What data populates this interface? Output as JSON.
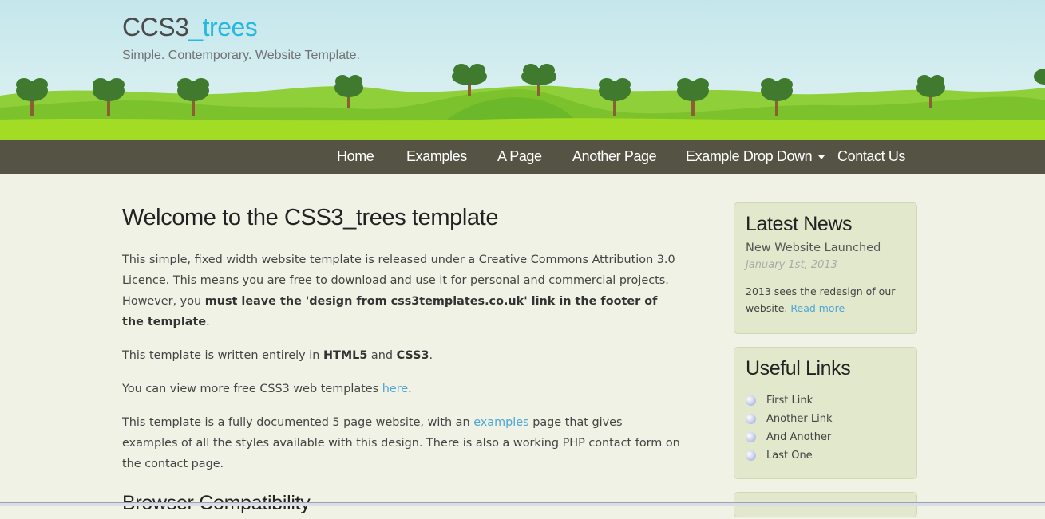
{
  "header": {
    "logo_main": "CCS3",
    "logo_accent": "_trees",
    "slogan": "Simple. Contemporary. Website Template."
  },
  "nav": {
    "items": [
      "Home",
      "Examples",
      "A Page",
      "Another Page",
      "Example Drop Down",
      "Contact Us"
    ]
  },
  "content": {
    "title": "Welcome to the CSS3_trees template",
    "p1_a": "This simple, fixed width website template is released under a Creative Commons Attribution 3.0 Licence. This means you are free to download and use it for personal and commercial projects. However, you ",
    "p1_bold": "must leave the 'design from css3templates.co.uk' link in the footer of the template",
    "p1_end": ".",
    "p2_a": "This template is written entirely in ",
    "p2_html5": "HTML5",
    "p2_and": " and ",
    "p2_css3": "CSS3",
    "p2_end": ".",
    "p3_a": "You can view more free CSS3 web templates ",
    "p3_link": "here",
    "p3_end": ".",
    "p4_a": "This template is a fully documented 5 page website, with an ",
    "p4_link": "examples",
    "p4_b": " page that gives examples of all the styles available with this design. There is also a working PHP contact form on the contact page.",
    "subtitle": "Browser Compatibility"
  },
  "sidebar": {
    "news": {
      "heading": "Latest News",
      "item_title": "New Website Launched",
      "item_date": "January 1st, 2013",
      "item_text": "2013 sees the redesign of our website. ",
      "read_more": "Read more"
    },
    "links": {
      "heading": "Useful Links",
      "items": [
        "First Link",
        "Another Link",
        "And Another",
        "Last One"
      ]
    }
  },
  "colors": {
    "accent": "#26b8e0",
    "nav_bg": "#555444",
    "page_bg": "#eff2e4",
    "sidebar_box": "#e2e8cb",
    "link": "#4ea6d6"
  }
}
